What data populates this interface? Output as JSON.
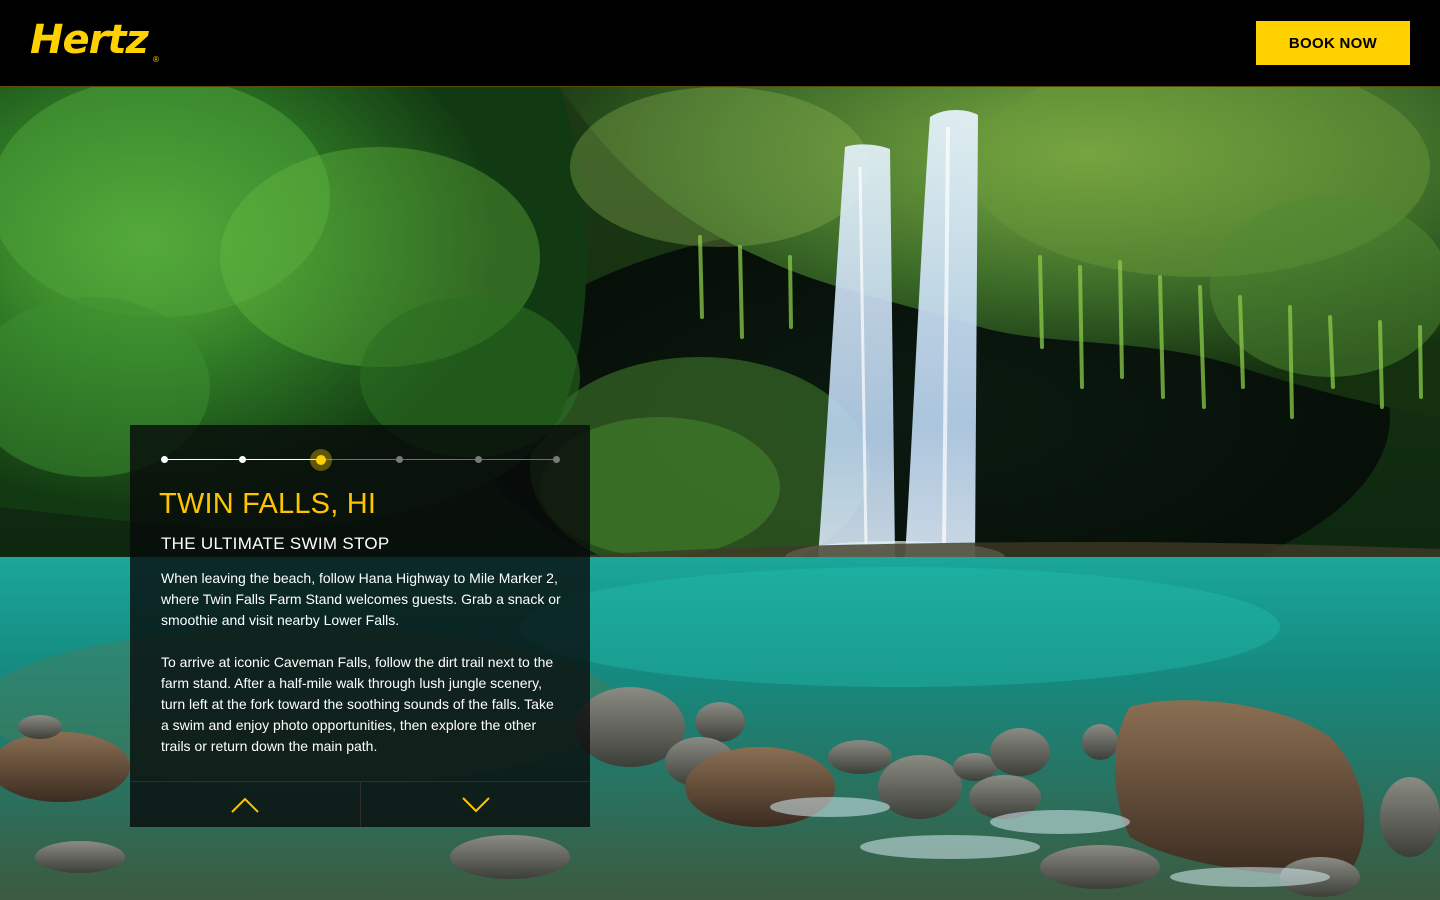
{
  "header": {
    "logo_text": "Hertz",
    "logo_mark": "®",
    "book_label": "BOOK NOW",
    "accent_color": "#ffd100"
  },
  "hero": {
    "image_icon": "waterfall-scene"
  },
  "card": {
    "steps_total": 6,
    "active_step": 3,
    "title": "TWIN FALLS, HI",
    "subtitle": "THE ULTIMATE SWIM STOP",
    "paragraphs": [
      "When leaving the beach, follow Hana Highway to Mile Marker 2, where Twin Falls Farm Stand welcomes guests. Grab a snack or smoothie and visit nearby Lower Falls.",
      "To arrive at iconic Caveman Falls, follow the dirt trail next to the farm stand. After a half-mile walk through lush jungle scenery, turn left at the fork toward the soothing sounds of the falls. Take a swim and enjoy photo opportunities, then explore the other trails or return down the main path."
    ],
    "nav": {
      "prev_icon": "chevron-up-icon",
      "next_icon": "chevron-down-icon"
    }
  }
}
